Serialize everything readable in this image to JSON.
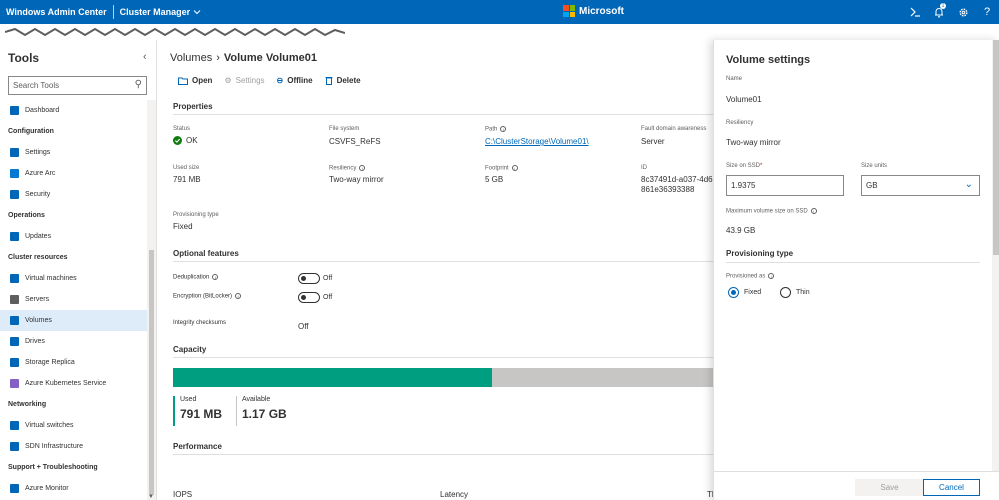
{
  "topbar": {
    "app_title": "Windows Admin Center",
    "context_label": "Cluster Manager",
    "brand": "Microsoft",
    "bg_color": "#0067b8",
    "icons": [
      "terminal-icon",
      "notification-icon",
      "gear-icon",
      "help-icon"
    ],
    "notification_count": "1"
  },
  "sidebar": {
    "heading": "Tools",
    "search_placeholder": "Search Tools",
    "sections": [
      {
        "title": "",
        "items": [
          {
            "label": "Dashboard",
            "icon": "home-icon"
          }
        ]
      },
      {
        "title": "Configuration",
        "items": [
          {
            "label": "Settings",
            "icon": "gear-icon"
          },
          {
            "label": "Azure Arc",
            "icon": "azure-arc-icon"
          },
          {
            "label": "Security",
            "icon": "shield-icon"
          }
        ]
      },
      {
        "title": "Operations",
        "items": [
          {
            "label": "Updates",
            "icon": "updates-icon"
          }
        ]
      },
      {
        "title": "Cluster resources",
        "items": [
          {
            "label": "Virtual machines",
            "icon": "vm-icon"
          },
          {
            "label": "Servers",
            "icon": "server-icon"
          },
          {
            "label": "Volumes",
            "icon": "volume-icon",
            "selected": true
          },
          {
            "label": "Drives",
            "icon": "drive-icon"
          },
          {
            "label": "Storage Replica",
            "icon": "replica-icon"
          },
          {
            "label": "Azure Kubernetes Service",
            "icon": "kubernetes-icon"
          }
        ]
      },
      {
        "title": "Networking",
        "items": [
          {
            "label": "Virtual switches",
            "icon": "switch-icon"
          },
          {
            "label": "SDN Infrastructure",
            "icon": "sdn-icon"
          }
        ]
      },
      {
        "title": "Support + Troubleshooting",
        "items": [
          {
            "label": "Azure Monitor",
            "icon": "monitor-icon"
          }
        ]
      }
    ]
  },
  "main": {
    "breadcrumb_parent": "Volumes",
    "breadcrumb_current": "Volume Volume01",
    "toolbar": {
      "open": "Open",
      "settings": "Settings",
      "offline": "Offline",
      "delete": "Delete"
    },
    "properties_heading": "Properties",
    "properties": {
      "status_label": "Status",
      "status_value": "OK",
      "fs_label": "File system",
      "fs_value": "CSVFS_ReFS",
      "path_label": "Path",
      "path_value": "C:\\ClusterStorage\\Volume01\\",
      "fda_label": "Fault domain awareness",
      "fda_value": "Server",
      "used_label": "Used size",
      "used_value": "791 MB",
      "resiliency_label": "Resiliency",
      "resiliency_value": "Two-way mirror",
      "footprint_label": "Footprint",
      "footprint_value": "5 GB",
      "id_label": "ID",
      "id_value_1": "8c37491d-a037-4d6",
      "id_value_2": "861e36393388",
      "prov_label": "Provisioning type",
      "prov_value": "Fixed"
    },
    "optional_heading": "Optional features",
    "optional": {
      "dedup_label": "Deduplication",
      "dedup_value": "Off",
      "enc_label": "Encryption (BitLocker)",
      "enc_value": "Off",
      "integrity_label": "Integrity checksums",
      "integrity_value": "Off"
    },
    "capacity_heading": "Capacity",
    "capacity": {
      "used_fraction": 0.59,
      "used_label": "Used",
      "used_value": "791 MB",
      "avail_label": "Available",
      "avail_value": "1.17 GB",
      "used_color": "#009e80",
      "free_color": "#c8c6c4"
    },
    "performance_heading": "Performance",
    "performance_cols": [
      "IOPS",
      "Latency",
      "Th"
    ]
  },
  "panel": {
    "title": "Volume settings",
    "name_label": "Name",
    "name_value": "Volume01",
    "resiliency_label": "Resiliency",
    "resiliency_value": "Two-way mirror",
    "size_label": "Size on SSD",
    "size_value": "1.9375",
    "units_label": "Size units",
    "units_value": "GB",
    "max_label": "Maximum volume size on SSD",
    "max_value": "43.9 GB",
    "prov_heading": "Provisioning type",
    "provisioned_as_label": "Provisioned as",
    "opt_fixed": "Fixed",
    "opt_thin": "Thin",
    "save": "Save",
    "cancel": "Cancel"
  }
}
